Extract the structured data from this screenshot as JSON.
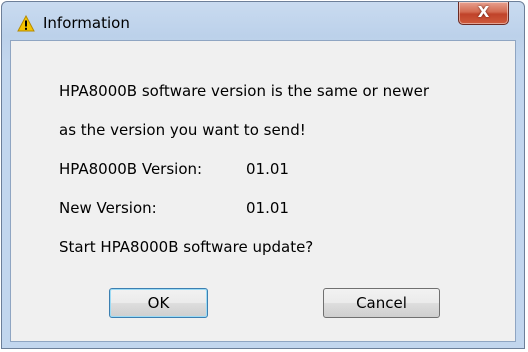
{
  "window": {
    "title": "Information",
    "title_icon": "warning-icon",
    "close_label": "X"
  },
  "message": {
    "line1": "HPA8000B software version is the same or newer",
    "line2": "as the version you want to send!",
    "current_label": "HPA8000B Version:",
    "current_value": "01.01",
    "new_label": "New Version:",
    "new_value": "01.01",
    "question": "Start HPA8000B software update?"
  },
  "buttons": {
    "ok": "OK",
    "cancel": "Cancel"
  },
  "colors": {
    "title_bar": "#c9dbf0",
    "close_button": "#c0432a",
    "client_bg": "#f0f0f0",
    "warning": "#f5c400"
  }
}
